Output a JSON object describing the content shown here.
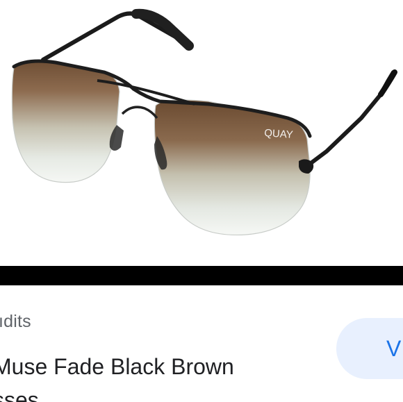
{
  "product": {
    "brand_mark": "QUAY",
    "source": "ıdits",
    "title": "Muse Fade Black Brown sses"
  },
  "actions": {
    "visit_label": "V"
  },
  "colors": {
    "accent": "#1a73e8",
    "button_bg": "#e8f0fe",
    "bar": "#000000"
  }
}
